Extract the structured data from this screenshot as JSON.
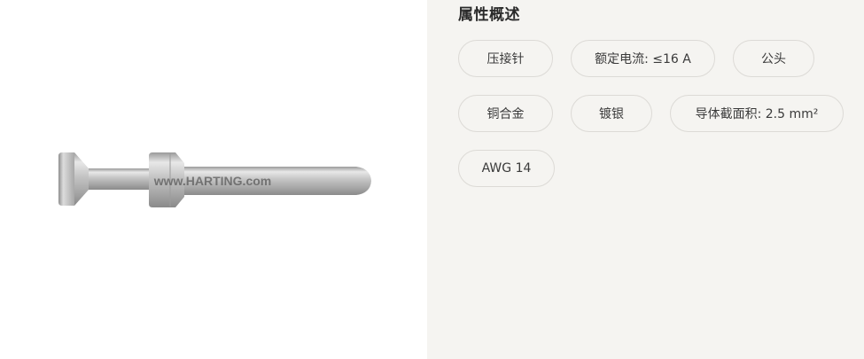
{
  "product_image": {
    "watermark": "www.HARTING.com"
  },
  "attributes": {
    "title": "属性概述",
    "chips": [
      "压接针",
      "额定电流: ≤16 A",
      "公头",
      "铜合金",
      "镀银",
      "导体截面积: 2.5 mm²",
      "AWG 14"
    ]
  },
  "colors": {
    "panel_background": "#f5f4f1",
    "chip_border": "#dcdad6",
    "text": "#3a3a3a"
  }
}
